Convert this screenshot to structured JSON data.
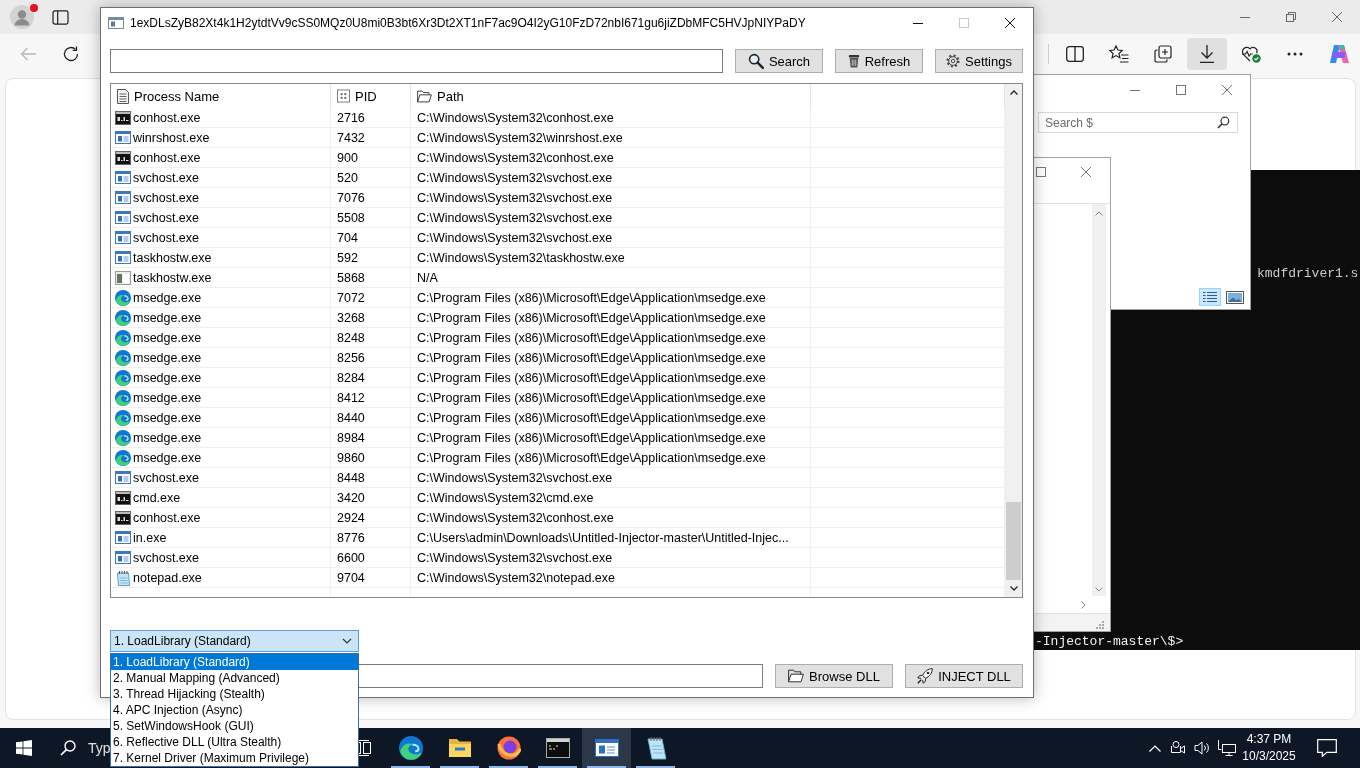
{
  "browser": {
    "profile": {
      "notification": true
    },
    "back_button": {
      "disabled": true
    },
    "toolbar": [
      {
        "kind": "split-screen",
        "selected": false
      },
      {
        "kind": "favorites",
        "selected": false
      },
      {
        "kind": "collections",
        "selected": false
      },
      {
        "kind": "downloads",
        "selected": true
      },
      {
        "kind": "browser-essentials",
        "selected": false
      },
      {
        "kind": "more",
        "selected": false
      },
      {
        "kind": "copilot",
        "selected": false
      }
    ]
  },
  "background_windows": {
    "explorer": {
      "search": {
        "placeholder": "Search $"
      },
      "views": [
        {
          "kind": "details",
          "selected": true
        },
        {
          "kind": "large-icons",
          "selected": false
        }
      ]
    },
    "terminal": {
      "output": "kmdfdriver1.s",
      "prompt": "-Injector-master\\$>"
    }
  },
  "window": {
    "title": "1exDLsZyB82Xt4k1H2ytdtVv9cSS0MQz0U8mi0B3bt6Xr3Dt2XT1nF7ac9O4I2yG10FzD72nbI671gu6jiZDbMFC5HVJpNIYPaDY",
    "maximize_button": {
      "disabled": true
    },
    "buttons": [
      {
        "kind": "search",
        "label": "Search"
      },
      {
        "kind": "refresh",
        "label": "Refresh"
      },
      {
        "kind": "settings",
        "label": "Settings"
      }
    ],
    "table": {
      "columns": [
        {
          "kind": "name",
          "label": "Process Name"
        },
        {
          "kind": "pid",
          "label": "PID"
        },
        {
          "kind": "path",
          "label": "Path"
        }
      ],
      "rows": [
        {
          "kind": "console",
          "name": "conhost.exe",
          "pid": "2716",
          "path": "C:\\Windows\\System32\\conhost.exe"
        },
        {
          "kind": "app",
          "name": "winrshost.exe",
          "pid": "7432",
          "path": "C:\\Windows\\System32\\winrshost.exe"
        },
        {
          "kind": "console",
          "name": "conhost.exe",
          "pid": "900",
          "path": "C:\\Windows\\System32\\conhost.exe"
        },
        {
          "kind": "app",
          "name": "svchost.exe",
          "pid": "520",
          "path": "C:\\Windows\\System32\\svchost.exe"
        },
        {
          "kind": "app",
          "name": "svchost.exe",
          "pid": "7076",
          "path": "C:\\Windows\\System32\\svchost.exe"
        },
        {
          "kind": "app",
          "name": "svchost.exe",
          "pid": "5508",
          "path": "C:\\Windows\\System32\\svchost.exe"
        },
        {
          "kind": "app",
          "name": "svchost.exe",
          "pid": "704",
          "path": "C:\\Windows\\System32\\svchost.exe"
        },
        {
          "kind": "app",
          "name": "taskhostw.exe",
          "pid": "592",
          "path": "C:\\Windows\\System32\\taskhostw.exe"
        },
        {
          "kind": "generic",
          "name": "taskhostw.exe",
          "pid": "5868",
          "path": "N/A"
        },
        {
          "kind": "edge",
          "name": "msedge.exe",
          "pid": "7072",
          "path": "C:\\Program Files (x86)\\Microsoft\\Edge\\Application\\msedge.exe"
        },
        {
          "kind": "edge",
          "name": "msedge.exe",
          "pid": "3268",
          "path": "C:\\Program Files (x86)\\Microsoft\\Edge\\Application\\msedge.exe"
        },
        {
          "kind": "edge",
          "name": "msedge.exe",
          "pid": "8248",
          "path": "C:\\Program Files (x86)\\Microsoft\\Edge\\Application\\msedge.exe"
        },
        {
          "kind": "edge",
          "name": "msedge.exe",
          "pid": "8256",
          "path": "C:\\Program Files (x86)\\Microsoft\\Edge\\Application\\msedge.exe"
        },
        {
          "kind": "edge",
          "name": "msedge.exe",
          "pid": "8284",
          "path": "C:\\Program Files (x86)\\Microsoft\\Edge\\Application\\msedge.exe"
        },
        {
          "kind": "edge",
          "name": "msedge.exe",
          "pid": "8412",
          "path": "C:\\Program Files (x86)\\Microsoft\\Edge\\Application\\msedge.exe"
        },
        {
          "kind": "edge",
          "name": "msedge.exe",
          "pid": "8440",
          "path": "C:\\Program Files (x86)\\Microsoft\\Edge\\Application\\msedge.exe"
        },
        {
          "kind": "edge",
          "name": "msedge.exe",
          "pid": "8984",
          "path": "C:\\Program Files (x86)\\Microsoft\\Edge\\Application\\msedge.exe"
        },
        {
          "kind": "edge",
          "name": "msedge.exe",
          "pid": "9860",
          "path": "C:\\Program Files (x86)\\Microsoft\\Edge\\Application\\msedge.exe"
        },
        {
          "kind": "app",
          "name": "svchost.exe",
          "pid": "8448",
          "path": "C:\\Windows\\System32\\svchost.exe"
        },
        {
          "kind": "console",
          "name": "cmd.exe",
          "pid": "3420",
          "path": "C:\\Windows\\System32\\cmd.exe"
        },
        {
          "kind": "console",
          "name": "conhost.exe",
          "pid": "2924",
          "path": "C:\\Windows\\System32\\conhost.exe"
        },
        {
          "kind": "app",
          "name": "in.exe",
          "pid": "8776",
          "path": "C:\\Users\\admin\\Downloads\\Untitled-Injector-master\\Untitled-Injec..."
        },
        {
          "kind": "app",
          "name": "svchost.exe",
          "pid": "6600",
          "path": "C:\\Windows\\System32\\svchost.exe"
        },
        {
          "kind": "notepad",
          "name": "notepad.exe",
          "pid": "9704",
          "path": "C:\\Windows\\System32\\notepad.exe"
        }
      ]
    },
    "method": {
      "value": "1. LoadLibrary (Standard)",
      "expanded": true,
      "options": [
        {
          "label": "1. LoadLibrary (Standard)",
          "selected": true
        },
        {
          "label": "2. Manual Mapping (Advanced)",
          "selected": false
        },
        {
          "label": "3. Thread Hijacking (Stealth)",
          "selected": false
        },
        {
          "label": "4. APC Injection (Async)",
          "selected": false
        },
        {
          "label": "5. SetWindowsHook (GUI)",
          "selected": false
        },
        {
          "label": "6. Reflective DLL (Ultra Stealth)",
          "selected": false
        },
        {
          "label": "7. Kernel Driver (Maximum Privilege)",
          "selected": false
        }
      ]
    },
    "dll_buttons": [
      {
        "kind": "browse",
        "label": "Browse DLL"
      },
      {
        "kind": "inject",
        "label": "INJECT DLL"
      }
    ]
  },
  "taskbar": {
    "search_text": "Typ",
    "apps": [
      {
        "kind": "edge",
        "selected": false,
        "running": true
      },
      {
        "kind": "file-explorer",
        "selected": false,
        "running": true
      },
      {
        "kind": "firefox",
        "selected": false,
        "running": true
      },
      {
        "kind": "terminal",
        "selected": false,
        "running": true
      },
      {
        "kind": "app",
        "selected": true,
        "running": true
      },
      {
        "kind": "notepad",
        "selected": false,
        "running": true
      }
    ],
    "clock": {
      "time": "4:37 PM",
      "date": "10/3/2025"
    }
  }
}
